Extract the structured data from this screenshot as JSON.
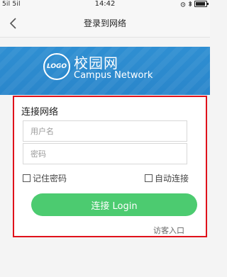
{
  "status_bar": {
    "carrier": "5il 5il",
    "time": "14:42",
    "icons": [
      "alarm-icon",
      "bluetooth-icon",
      "battery-icon"
    ]
  },
  "nav": {
    "title": "登录到网络",
    "back_icon": "chevron-left-icon"
  },
  "banner": {
    "logo_text": "LOGO",
    "title": "校园网",
    "subtitle": "Campus Network",
    "color": "#2c8bd0"
  },
  "login": {
    "title": "连接网络",
    "username_placeholder": "用户名",
    "password_placeholder": "密码",
    "remember_label": "记住密码",
    "auto_connect_label": "自动连接",
    "connect_label": "连接 Login",
    "guest_label": "访客入口",
    "button_color": "#4ccb70",
    "highlight_color": "#e0121b"
  }
}
